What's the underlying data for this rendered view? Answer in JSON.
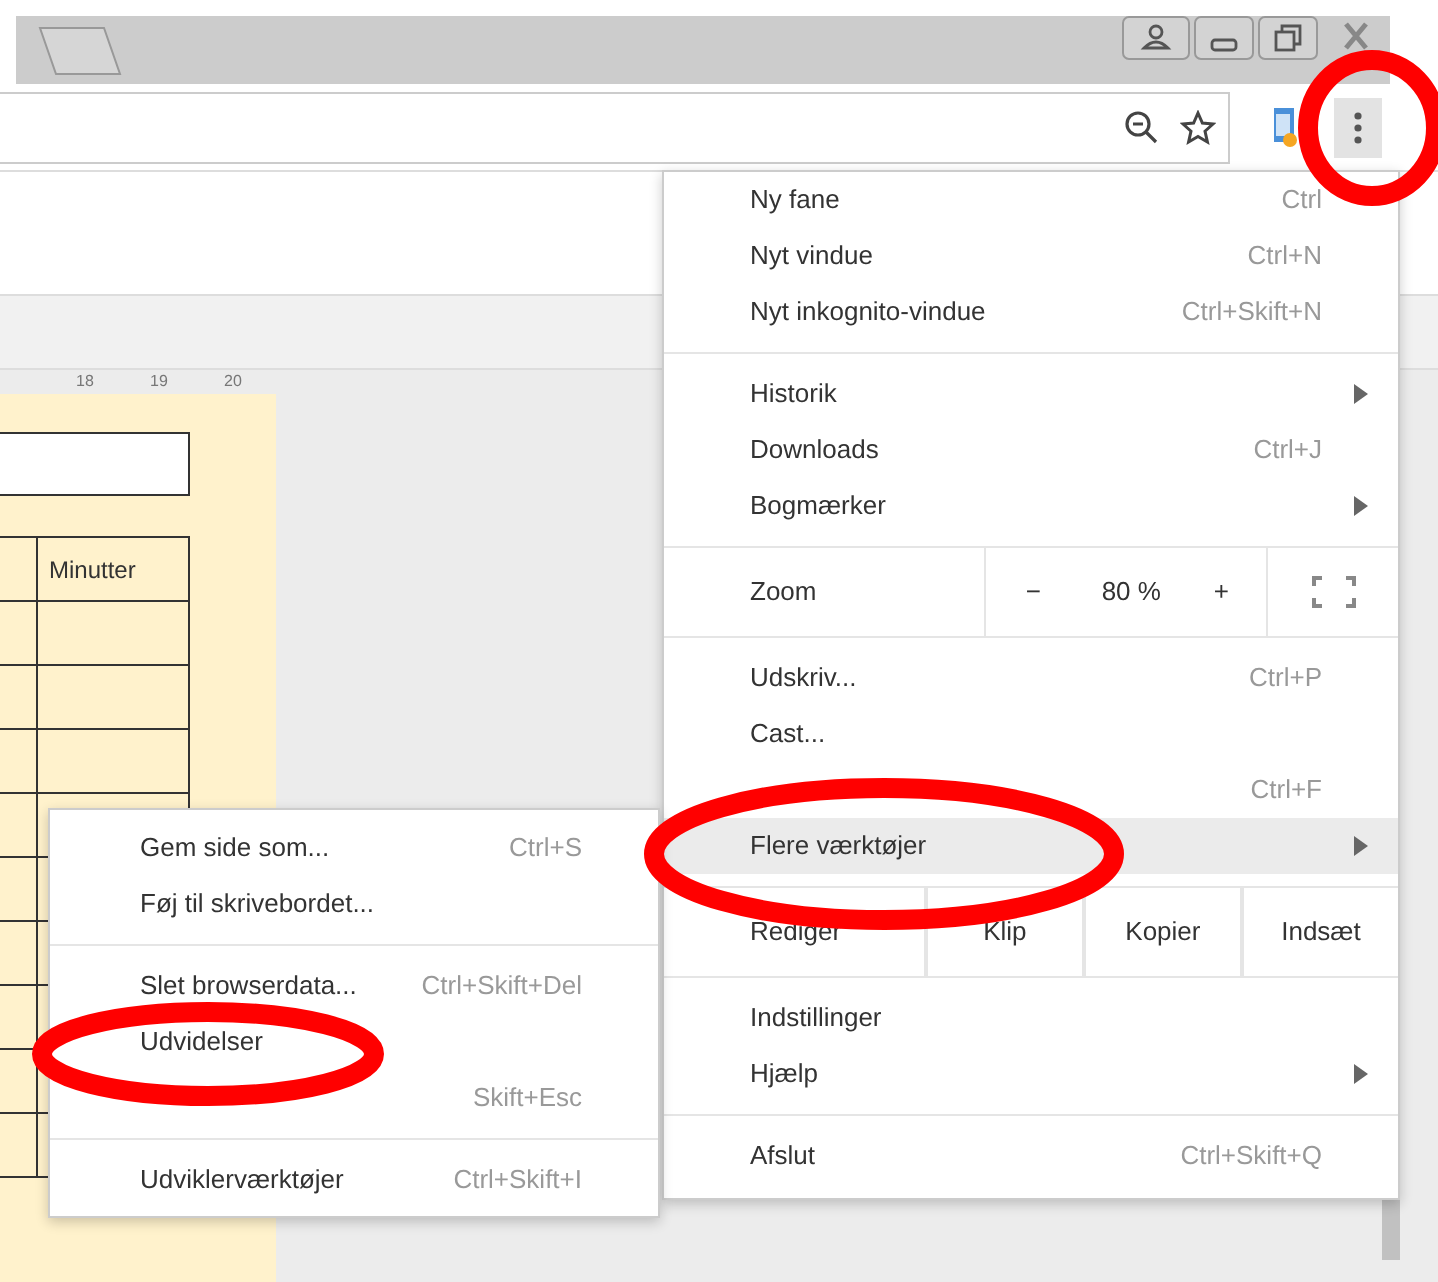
{
  "ruler": {
    "labels": [
      "18",
      "19",
      "20"
    ]
  },
  "document": {
    "table": {
      "columns": [
        "Minutter"
      ]
    }
  },
  "menu": {
    "items": [
      {
        "kind": "item",
        "label": "Ny fane",
        "shortcut": "Ctrl",
        "has_submenu": false,
        "selected": false
      },
      {
        "kind": "item",
        "label": "Nyt vindue",
        "shortcut": "Ctrl+N",
        "has_submenu": false,
        "selected": false
      },
      {
        "kind": "item",
        "label": "Nyt inkognito-vindue",
        "shortcut": "Ctrl+Skift+N",
        "has_submenu": false,
        "selected": false
      },
      {
        "kind": "separator"
      },
      {
        "kind": "item",
        "label": "Historik",
        "has_submenu": true,
        "selected": false
      },
      {
        "kind": "item",
        "label": "Downloads",
        "shortcut": "Ctrl+J",
        "has_submenu": false,
        "selected": false
      },
      {
        "kind": "item",
        "label": "Bogmærker",
        "has_submenu": true,
        "selected": false
      },
      {
        "kind": "zoom",
        "label": "Zoom",
        "minus": "−",
        "value": "80 %",
        "plus": "+"
      },
      {
        "kind": "item",
        "label": "Udskriv...",
        "shortcut": "Ctrl+P",
        "has_submenu": false,
        "selected": false
      },
      {
        "kind": "item",
        "label": "Cast...",
        "has_submenu": false,
        "selected": false
      },
      {
        "kind": "item",
        "shortcut": "Ctrl+F",
        "has_submenu": false,
        "selected": false
      },
      {
        "kind": "item",
        "label": "Flere værktøjer",
        "has_submenu": true,
        "selected": true
      },
      {
        "kind": "edit",
        "label": "Rediger",
        "actions": [
          "Klip",
          "Kopier",
          "Indsæt"
        ]
      },
      {
        "kind": "item",
        "label": "Indstillinger",
        "has_submenu": false,
        "selected": false
      },
      {
        "kind": "item",
        "label": "Hjælp",
        "has_submenu": true,
        "selected": false
      },
      {
        "kind": "separator"
      },
      {
        "kind": "item",
        "label": "Afslut",
        "shortcut": "Ctrl+Skift+Q",
        "has_submenu": false,
        "selected": false
      }
    ]
  },
  "submenu": {
    "items": [
      {
        "kind": "item",
        "label": "Gem side som...",
        "shortcut": "Ctrl+S",
        "selected": false
      },
      {
        "kind": "item",
        "label": "Føj til skrivebordet...",
        "selected": false
      },
      {
        "kind": "separator"
      },
      {
        "kind": "item",
        "label": "Slet browserdata...",
        "shortcut": "Ctrl+Skift+Del",
        "selected": false
      },
      {
        "kind": "item",
        "label": "Udvidelser",
        "selected": false
      },
      {
        "kind": "item",
        "shortcut": "Skift+Esc",
        "selected": false
      },
      {
        "kind": "separator"
      },
      {
        "kind": "item",
        "label": "Udviklerværktøjer",
        "shortcut": "Ctrl+Skift+I",
        "selected": false
      }
    ]
  }
}
